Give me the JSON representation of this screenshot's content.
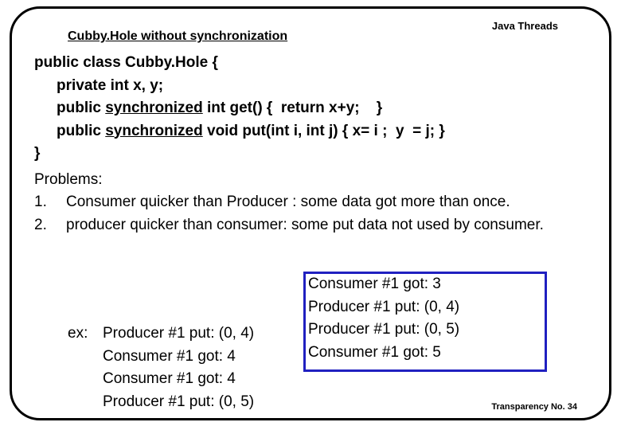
{
  "header": {
    "topic": "Java Threads"
  },
  "subtitle": "Cubby.Hole without synchronization",
  "code": {
    "l1": "public class Cubby.Hole {",
    "l2_pre": "private int x, y;",
    "l3_a": "public ",
    "l3_sync": "synchronized",
    "l3_b": " int get() {  return x+y;    }",
    "l4_a": "public ",
    "l4_sync": "synchronized",
    "l4_b": " void put(int i, int j) { x= i ;  y  = j; }",
    "l5": "}"
  },
  "problems": {
    "heading": "Problems:",
    "items": [
      {
        "num": "1.",
        "text": "Consumer quicker than Producer : some data got more than once."
      },
      {
        "num": "2.",
        "text": "producer quicker than consumer: some put data not used by consumer."
      }
    ],
    "ex_label": "ex:",
    "left_lines": [
      "Producer #1   put:  (0, 4)",
      "Consumer #1 got: 4",
      "Consumer #1 got: 4",
      "Producer #1   put: (0, 5)"
    ],
    "right_lines": [
      "Consumer #1  got: 3",
      "Producer #1    put: (0, 4)",
      "Producer #1    put: (0, 5)",
      "Consumer #1  got: 5"
    ]
  },
  "footer": "Transparency No. 34"
}
